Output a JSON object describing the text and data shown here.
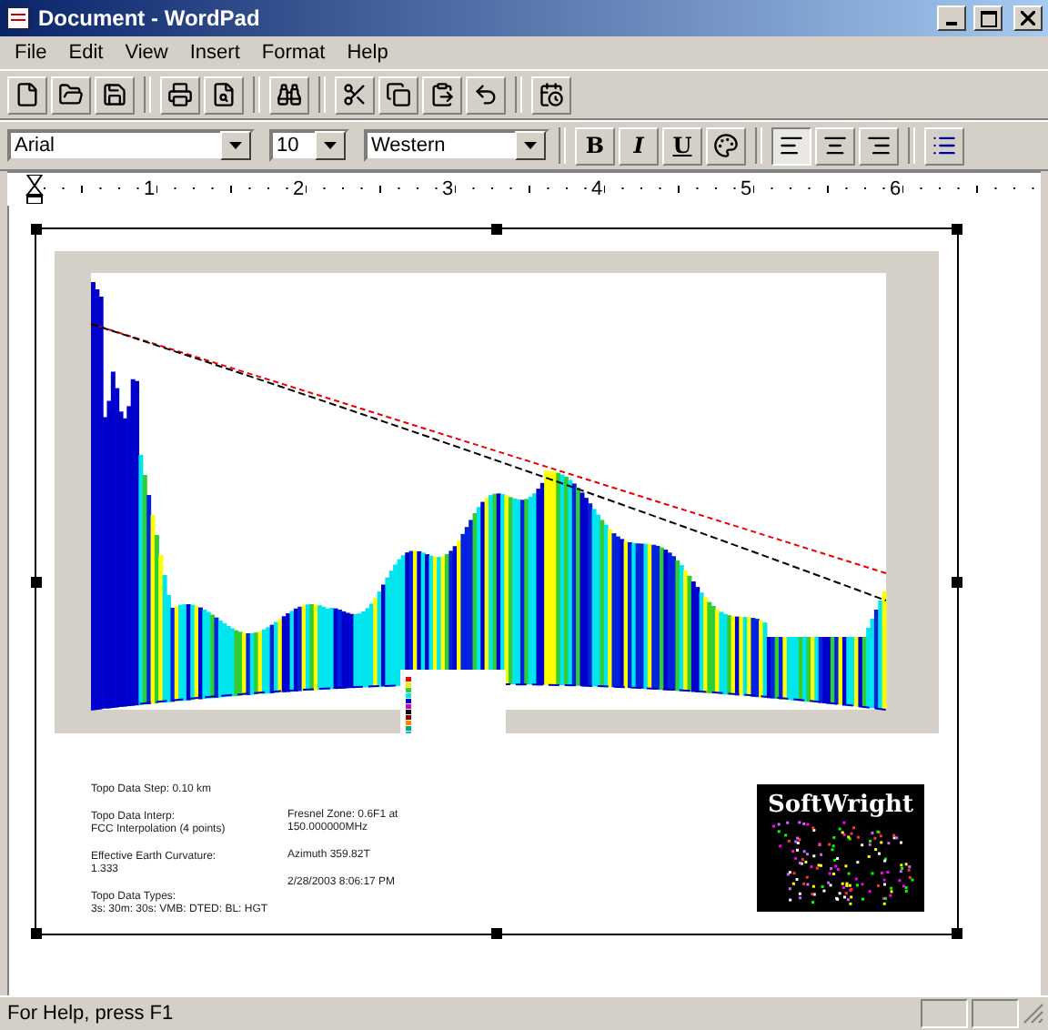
{
  "window": {
    "title": "Document - WordPad"
  },
  "menu": [
    "File",
    "Edit",
    "View",
    "Insert",
    "Format",
    "Help"
  ],
  "format_bar": {
    "font": "Arial",
    "size": "10",
    "script": "Western",
    "style_buttons": [
      "B",
      "I",
      "U"
    ],
    "align_buttons": [
      {
        "selected": true
      },
      {
        "selected": false
      },
      {
        "selected": false
      }
    ],
    "bullets": {
      "selected": false
    }
  },
  "ruler": {
    "labels": [
      "1",
      "2",
      "3",
      "4",
      "5",
      "6"
    ]
  },
  "document": {
    "notes_left": [
      "Topo Data Step: 0.10 km",
      "Topo Data Interp:\nFCC Interpolation (4 points)",
      "Effective Earth Curvature:\n1.333",
      "Topo Data Types:\n3s: 30m: 30s: VMB: DTED: BL: HGT"
    ],
    "notes_right": [
      "Fresnel Zone: 0.6F1 at\n150.000000MHz",
      "Azimuth 359.82T",
      "2/28/2003 8:06:17 PM"
    ],
    "logo": "SoftWright"
  },
  "status_bar": {
    "text": "For Help, press F1"
  }
}
